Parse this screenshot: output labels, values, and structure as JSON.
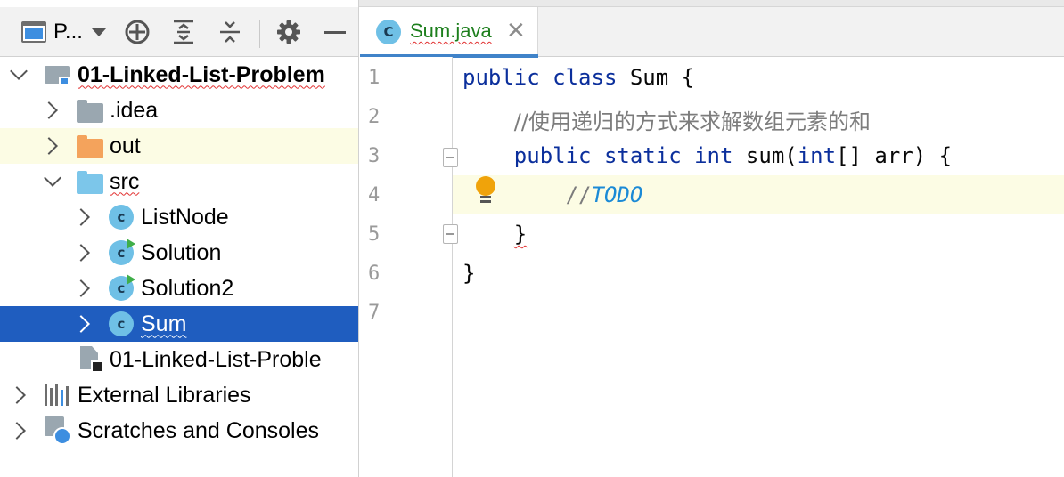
{
  "project_panel": {
    "view_selector_label": "P...",
    "toolbar_icons": [
      "window-icon",
      "crosshair-icon",
      "expand-all-icon",
      "collapse-all-icon",
      "gear-icon",
      "minimize-icon"
    ],
    "tree": [
      {
        "label": "01-Linked-List-Problem",
        "type": "module",
        "expanded": true
      },
      {
        "label": ".idea",
        "type": "folder",
        "color": "#9aa7b0",
        "expanded": false
      },
      {
        "label": "out",
        "type": "folder",
        "color": "#f4a35c",
        "expanded": false,
        "highlighted": true
      },
      {
        "label": "src",
        "type": "folder",
        "color": "#7cc6ea",
        "expanded": true
      },
      {
        "label": "ListNode",
        "type": "class"
      },
      {
        "label": "Solution",
        "type": "class-runnable"
      },
      {
        "label": "Solution2",
        "type": "class-runnable"
      },
      {
        "label": "Sum",
        "type": "class",
        "selected": true
      },
      {
        "label": "01-Linked-List-Proble",
        "type": "iml-file"
      },
      {
        "label": "External Libraries",
        "type": "libraries"
      },
      {
        "label": "Scratches and Consoles",
        "type": "scratches"
      }
    ]
  },
  "editor": {
    "tab": {
      "icon_letter": "C",
      "name": "Sum.java",
      "close": "✕"
    },
    "line_numbers": [
      "1",
      "2",
      "3",
      "4",
      "5",
      "6",
      "7"
    ],
    "current_line": 4,
    "code": {
      "line1_kw1": "public",
      "line1_kw2": "class",
      "line1_rest": "Sum {",
      "line2_comment": "//使用递归的方式来求解数组元素的和",
      "line3_kw1": "public",
      "line3_kw2": "static",
      "line3_kw3": "int",
      "line3_name": "sum(",
      "line3_kw4": "int",
      "line3_rest": "[] arr) {",
      "line4_slashes": "//",
      "line4_todo": "TODO",
      "line5": "}",
      "line6": "}"
    }
  },
  "colors": {
    "selection": "#1f5dbf",
    "keyword": "#0b2f9c",
    "todo": "#1b8ad6",
    "highlight_row": "#fcfce4",
    "tab_name": "#1d7f1d"
  }
}
